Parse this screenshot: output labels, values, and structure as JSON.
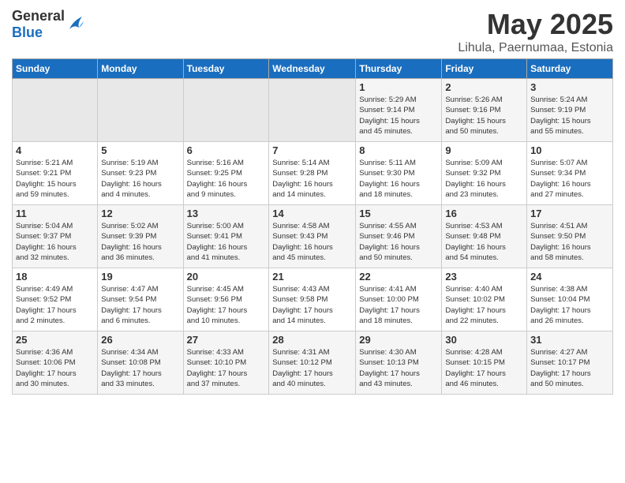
{
  "logo": {
    "general": "General",
    "blue": "Blue"
  },
  "title": {
    "month_year": "May 2025",
    "location": "Lihula, Paernumaa, Estonia"
  },
  "headers": [
    "Sunday",
    "Monday",
    "Tuesday",
    "Wednesday",
    "Thursday",
    "Friday",
    "Saturday"
  ],
  "weeks": [
    [
      {
        "num": "",
        "info": "",
        "empty": true
      },
      {
        "num": "",
        "info": "",
        "empty": true
      },
      {
        "num": "",
        "info": "",
        "empty": true
      },
      {
        "num": "",
        "info": "",
        "empty": true
      },
      {
        "num": "1",
        "info": "Sunrise: 5:29 AM\nSunset: 9:14 PM\nDaylight: 15 hours\nand 45 minutes.",
        "empty": false
      },
      {
        "num": "2",
        "info": "Sunrise: 5:26 AM\nSunset: 9:16 PM\nDaylight: 15 hours\nand 50 minutes.",
        "empty": false
      },
      {
        "num": "3",
        "info": "Sunrise: 5:24 AM\nSunset: 9:19 PM\nDaylight: 15 hours\nand 55 minutes.",
        "empty": false
      }
    ],
    [
      {
        "num": "4",
        "info": "Sunrise: 5:21 AM\nSunset: 9:21 PM\nDaylight: 15 hours\nand 59 minutes.",
        "empty": false
      },
      {
        "num": "5",
        "info": "Sunrise: 5:19 AM\nSunset: 9:23 PM\nDaylight: 16 hours\nand 4 minutes.",
        "empty": false
      },
      {
        "num": "6",
        "info": "Sunrise: 5:16 AM\nSunset: 9:25 PM\nDaylight: 16 hours\nand 9 minutes.",
        "empty": false
      },
      {
        "num": "7",
        "info": "Sunrise: 5:14 AM\nSunset: 9:28 PM\nDaylight: 16 hours\nand 14 minutes.",
        "empty": false
      },
      {
        "num": "8",
        "info": "Sunrise: 5:11 AM\nSunset: 9:30 PM\nDaylight: 16 hours\nand 18 minutes.",
        "empty": false
      },
      {
        "num": "9",
        "info": "Sunrise: 5:09 AM\nSunset: 9:32 PM\nDaylight: 16 hours\nand 23 minutes.",
        "empty": false
      },
      {
        "num": "10",
        "info": "Sunrise: 5:07 AM\nSunset: 9:34 PM\nDaylight: 16 hours\nand 27 minutes.",
        "empty": false
      }
    ],
    [
      {
        "num": "11",
        "info": "Sunrise: 5:04 AM\nSunset: 9:37 PM\nDaylight: 16 hours\nand 32 minutes.",
        "empty": false
      },
      {
        "num": "12",
        "info": "Sunrise: 5:02 AM\nSunset: 9:39 PM\nDaylight: 16 hours\nand 36 minutes.",
        "empty": false
      },
      {
        "num": "13",
        "info": "Sunrise: 5:00 AM\nSunset: 9:41 PM\nDaylight: 16 hours\nand 41 minutes.",
        "empty": false
      },
      {
        "num": "14",
        "info": "Sunrise: 4:58 AM\nSunset: 9:43 PM\nDaylight: 16 hours\nand 45 minutes.",
        "empty": false
      },
      {
        "num": "15",
        "info": "Sunrise: 4:55 AM\nSunset: 9:46 PM\nDaylight: 16 hours\nand 50 minutes.",
        "empty": false
      },
      {
        "num": "16",
        "info": "Sunrise: 4:53 AM\nSunset: 9:48 PM\nDaylight: 16 hours\nand 54 minutes.",
        "empty": false
      },
      {
        "num": "17",
        "info": "Sunrise: 4:51 AM\nSunset: 9:50 PM\nDaylight: 16 hours\nand 58 minutes.",
        "empty": false
      }
    ],
    [
      {
        "num": "18",
        "info": "Sunrise: 4:49 AM\nSunset: 9:52 PM\nDaylight: 17 hours\nand 2 minutes.",
        "empty": false
      },
      {
        "num": "19",
        "info": "Sunrise: 4:47 AM\nSunset: 9:54 PM\nDaylight: 17 hours\nand 6 minutes.",
        "empty": false
      },
      {
        "num": "20",
        "info": "Sunrise: 4:45 AM\nSunset: 9:56 PM\nDaylight: 17 hours\nand 10 minutes.",
        "empty": false
      },
      {
        "num": "21",
        "info": "Sunrise: 4:43 AM\nSunset: 9:58 PM\nDaylight: 17 hours\nand 14 minutes.",
        "empty": false
      },
      {
        "num": "22",
        "info": "Sunrise: 4:41 AM\nSunset: 10:00 PM\nDaylight: 17 hours\nand 18 minutes.",
        "empty": false
      },
      {
        "num": "23",
        "info": "Sunrise: 4:40 AM\nSunset: 10:02 PM\nDaylight: 17 hours\nand 22 minutes.",
        "empty": false
      },
      {
        "num": "24",
        "info": "Sunrise: 4:38 AM\nSunset: 10:04 PM\nDaylight: 17 hours\nand 26 minutes.",
        "empty": false
      }
    ],
    [
      {
        "num": "25",
        "info": "Sunrise: 4:36 AM\nSunset: 10:06 PM\nDaylight: 17 hours\nand 30 minutes.",
        "empty": false
      },
      {
        "num": "26",
        "info": "Sunrise: 4:34 AM\nSunset: 10:08 PM\nDaylight: 17 hours\nand 33 minutes.",
        "empty": false
      },
      {
        "num": "27",
        "info": "Sunrise: 4:33 AM\nSunset: 10:10 PM\nDaylight: 17 hours\nand 37 minutes.",
        "empty": false
      },
      {
        "num": "28",
        "info": "Sunrise: 4:31 AM\nSunset: 10:12 PM\nDaylight: 17 hours\nand 40 minutes.",
        "empty": false
      },
      {
        "num": "29",
        "info": "Sunrise: 4:30 AM\nSunset: 10:13 PM\nDaylight: 17 hours\nand 43 minutes.",
        "empty": false
      },
      {
        "num": "30",
        "info": "Sunrise: 4:28 AM\nSunset: 10:15 PM\nDaylight: 17 hours\nand 46 minutes.",
        "empty": false
      },
      {
        "num": "31",
        "info": "Sunrise: 4:27 AM\nSunset: 10:17 PM\nDaylight: 17 hours\nand 50 minutes.",
        "empty": false
      }
    ]
  ]
}
